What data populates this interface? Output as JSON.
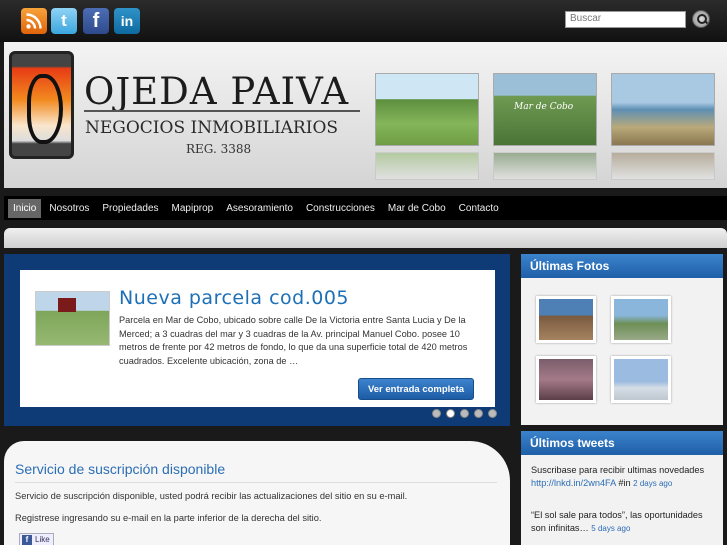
{
  "topbar": {
    "social": [
      {
        "name": "rss-icon",
        "glyph": ""
      },
      {
        "name": "twitter-icon",
        "glyph": "t"
      },
      {
        "name": "facebook-icon",
        "glyph": "f"
      },
      {
        "name": "linkedin-icon",
        "glyph": "in"
      }
    ],
    "search_placeholder": "Buscar"
  },
  "header": {
    "title": "OJEDA PAIVA",
    "subtitle": "NEGOCIOS INMOBILIARIOS",
    "reg": "REG. 3388",
    "photo_caption": "Mar de Cobo"
  },
  "nav": {
    "items": [
      "Inicio",
      "Nosotros",
      "Propiedades",
      "Mapiprop",
      "Asesoramiento",
      "Construcciones",
      "Mar de Cobo",
      "Contacto"
    ],
    "active": "Inicio"
  },
  "slider": {
    "title": "Nueva parcela cod.005",
    "text": "Parcela en Mar de Cobo, ubicado sobre calle De la Victoria entre Santa Lucia y De la Merced; a 3 cuadras del mar y 3 cuadras de la Av. principal Manuel Cobo. posee 10 metros de frente por 42 metros de fondo, lo que da una superficie total de 420 metros cuadrados. Excelente ubicación, zona de …",
    "button": "Ver entrada completa",
    "slide_count": 5,
    "current_slide": 2
  },
  "content": {
    "title": "Servicio de suscripción disponible",
    "paragraph1": "Servicio de suscripción disponible, usted podrá recibir las actualizaciones del sitio en su e-mail.",
    "paragraph2": "Registrese ingresando su e-mail en la parte inferior de la derecha del sitio.",
    "like": "Like"
  },
  "sidebar": {
    "photos_title": "Últimas Fotos",
    "tweets_title": "Últimos tweets",
    "tweets": [
      {
        "text": "Suscribase para recibir ultimas novedades ",
        "link": "http://lnkd.in/2wn4FA",
        "tag": " #in",
        "ago": "2 days ago"
      },
      {
        "text": "“El sol sale para todos”, las oportunidades son infinitas… ",
        "link": "",
        "tag": "",
        "ago": "5 days ago"
      }
    ]
  }
}
